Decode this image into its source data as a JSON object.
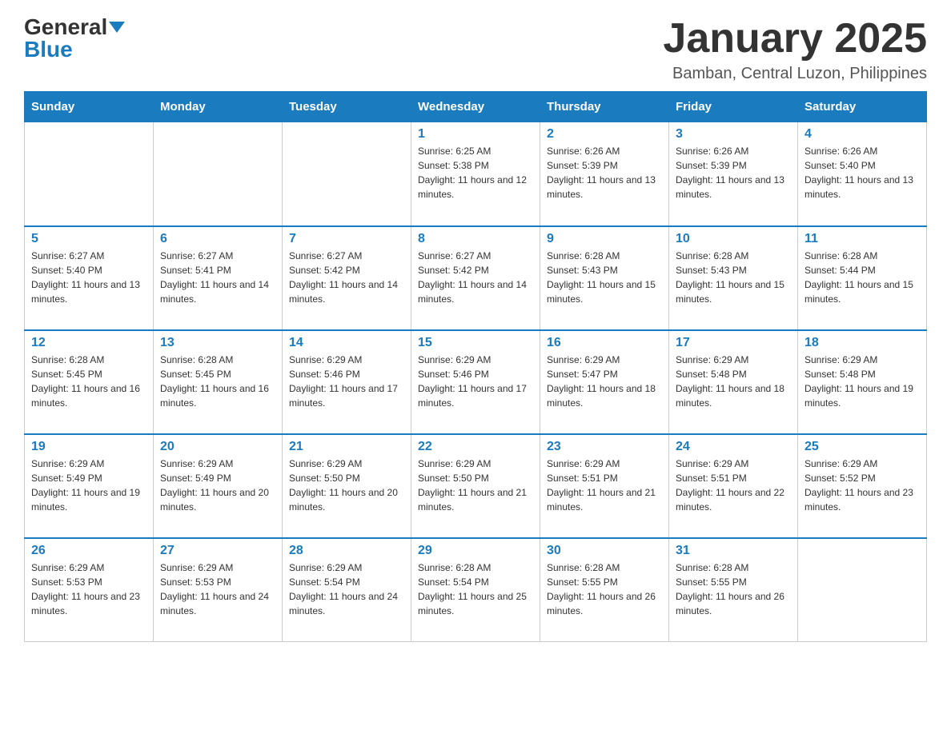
{
  "header": {
    "logo_general": "General",
    "logo_blue": "Blue",
    "month_title": "January 2025",
    "location": "Bamban, Central Luzon, Philippines"
  },
  "days_of_week": [
    "Sunday",
    "Monday",
    "Tuesday",
    "Wednesday",
    "Thursday",
    "Friday",
    "Saturday"
  ],
  "weeks": [
    [
      {
        "day": "",
        "info": ""
      },
      {
        "day": "",
        "info": ""
      },
      {
        "day": "",
        "info": ""
      },
      {
        "day": "1",
        "info": "Sunrise: 6:25 AM\nSunset: 5:38 PM\nDaylight: 11 hours and 12 minutes."
      },
      {
        "day": "2",
        "info": "Sunrise: 6:26 AM\nSunset: 5:39 PM\nDaylight: 11 hours and 13 minutes."
      },
      {
        "day": "3",
        "info": "Sunrise: 6:26 AM\nSunset: 5:39 PM\nDaylight: 11 hours and 13 minutes."
      },
      {
        "day": "4",
        "info": "Sunrise: 6:26 AM\nSunset: 5:40 PM\nDaylight: 11 hours and 13 minutes."
      }
    ],
    [
      {
        "day": "5",
        "info": "Sunrise: 6:27 AM\nSunset: 5:40 PM\nDaylight: 11 hours and 13 minutes."
      },
      {
        "day": "6",
        "info": "Sunrise: 6:27 AM\nSunset: 5:41 PM\nDaylight: 11 hours and 14 minutes."
      },
      {
        "day": "7",
        "info": "Sunrise: 6:27 AM\nSunset: 5:42 PM\nDaylight: 11 hours and 14 minutes."
      },
      {
        "day": "8",
        "info": "Sunrise: 6:27 AM\nSunset: 5:42 PM\nDaylight: 11 hours and 14 minutes."
      },
      {
        "day": "9",
        "info": "Sunrise: 6:28 AM\nSunset: 5:43 PM\nDaylight: 11 hours and 15 minutes."
      },
      {
        "day": "10",
        "info": "Sunrise: 6:28 AM\nSunset: 5:43 PM\nDaylight: 11 hours and 15 minutes."
      },
      {
        "day": "11",
        "info": "Sunrise: 6:28 AM\nSunset: 5:44 PM\nDaylight: 11 hours and 15 minutes."
      }
    ],
    [
      {
        "day": "12",
        "info": "Sunrise: 6:28 AM\nSunset: 5:45 PM\nDaylight: 11 hours and 16 minutes."
      },
      {
        "day": "13",
        "info": "Sunrise: 6:28 AM\nSunset: 5:45 PM\nDaylight: 11 hours and 16 minutes."
      },
      {
        "day": "14",
        "info": "Sunrise: 6:29 AM\nSunset: 5:46 PM\nDaylight: 11 hours and 17 minutes."
      },
      {
        "day": "15",
        "info": "Sunrise: 6:29 AM\nSunset: 5:46 PM\nDaylight: 11 hours and 17 minutes."
      },
      {
        "day": "16",
        "info": "Sunrise: 6:29 AM\nSunset: 5:47 PM\nDaylight: 11 hours and 18 minutes."
      },
      {
        "day": "17",
        "info": "Sunrise: 6:29 AM\nSunset: 5:48 PM\nDaylight: 11 hours and 18 minutes."
      },
      {
        "day": "18",
        "info": "Sunrise: 6:29 AM\nSunset: 5:48 PM\nDaylight: 11 hours and 19 minutes."
      }
    ],
    [
      {
        "day": "19",
        "info": "Sunrise: 6:29 AM\nSunset: 5:49 PM\nDaylight: 11 hours and 19 minutes."
      },
      {
        "day": "20",
        "info": "Sunrise: 6:29 AM\nSunset: 5:49 PM\nDaylight: 11 hours and 20 minutes."
      },
      {
        "day": "21",
        "info": "Sunrise: 6:29 AM\nSunset: 5:50 PM\nDaylight: 11 hours and 20 minutes."
      },
      {
        "day": "22",
        "info": "Sunrise: 6:29 AM\nSunset: 5:50 PM\nDaylight: 11 hours and 21 minutes."
      },
      {
        "day": "23",
        "info": "Sunrise: 6:29 AM\nSunset: 5:51 PM\nDaylight: 11 hours and 21 minutes."
      },
      {
        "day": "24",
        "info": "Sunrise: 6:29 AM\nSunset: 5:51 PM\nDaylight: 11 hours and 22 minutes."
      },
      {
        "day": "25",
        "info": "Sunrise: 6:29 AM\nSunset: 5:52 PM\nDaylight: 11 hours and 23 minutes."
      }
    ],
    [
      {
        "day": "26",
        "info": "Sunrise: 6:29 AM\nSunset: 5:53 PM\nDaylight: 11 hours and 23 minutes."
      },
      {
        "day": "27",
        "info": "Sunrise: 6:29 AM\nSunset: 5:53 PM\nDaylight: 11 hours and 24 minutes."
      },
      {
        "day": "28",
        "info": "Sunrise: 6:29 AM\nSunset: 5:54 PM\nDaylight: 11 hours and 24 minutes."
      },
      {
        "day": "29",
        "info": "Sunrise: 6:28 AM\nSunset: 5:54 PM\nDaylight: 11 hours and 25 minutes."
      },
      {
        "day": "30",
        "info": "Sunrise: 6:28 AM\nSunset: 5:55 PM\nDaylight: 11 hours and 26 minutes."
      },
      {
        "day": "31",
        "info": "Sunrise: 6:28 AM\nSunset: 5:55 PM\nDaylight: 11 hours and 26 minutes."
      },
      {
        "day": "",
        "info": ""
      }
    ]
  ]
}
